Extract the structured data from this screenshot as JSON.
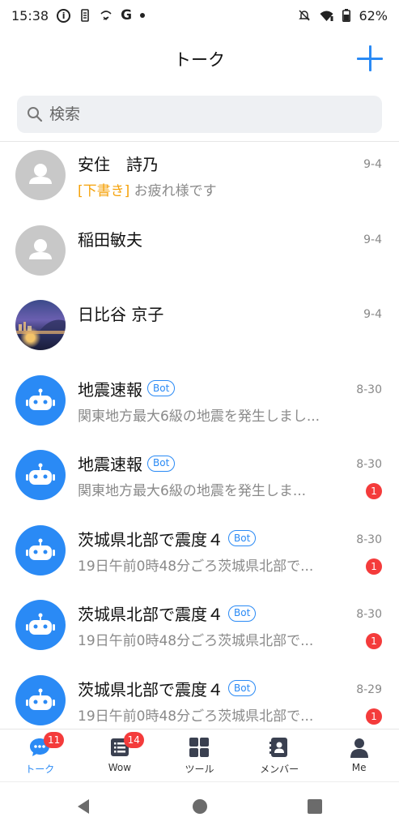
{
  "status_bar": {
    "time": "15:38",
    "g_letter": "G",
    "battery": "62%"
  },
  "header": {
    "title": "トーク"
  },
  "search": {
    "placeholder": "検索"
  },
  "chats": [
    {
      "name": "安住　詩乃",
      "draft_label": "[下書き]",
      "preview": "お疲れ様です",
      "date": "9-4",
      "avatar": "default-user-icon"
    },
    {
      "name": "稲田敏夫",
      "preview": "",
      "date": "9-4",
      "avatar": "default-user-icon"
    },
    {
      "name": "日比谷 京子",
      "preview": "",
      "date": "9-4",
      "avatar": "photo"
    },
    {
      "name": "地震速報",
      "bot": "Bot",
      "preview": "関東地方最大6級の地震を発生しまし...",
      "date": "8-30",
      "avatar": "robot-icon"
    },
    {
      "name": "地震速報",
      "bot": "Bot",
      "preview": "関東地方最大6級の地震を発生しま...",
      "date": "8-30",
      "unread": "1",
      "avatar": "robot-icon"
    },
    {
      "name": "茨城県北部で震度４",
      "bot": "Bot",
      "preview": "19日午前0時48分ごろ茨城県北部で...",
      "date": "8-30",
      "unread": "1",
      "avatar": "robot-icon"
    },
    {
      "name": "茨城県北部で震度４",
      "bot": "Bot",
      "preview": "19日午前0時48分ごろ茨城県北部で...",
      "date": "8-30",
      "unread": "1",
      "avatar": "robot-icon"
    },
    {
      "name": "茨城県北部で震度４",
      "bot": "Bot",
      "preview": "19日午前0時48分ごろ茨城県北部で...",
      "date": "8-29",
      "unread": "1",
      "avatar": "robot-icon"
    }
  ],
  "bottom_nav": [
    {
      "label": "トーク",
      "badge": "11",
      "icon": "chat-bubble-icon",
      "active": true
    },
    {
      "label": "Wow",
      "badge": "14",
      "icon": "list-icon",
      "active": false
    },
    {
      "label": "ツール",
      "icon": "grid-icon",
      "active": false
    },
    {
      "label": "メンバー",
      "icon": "contact-card-icon",
      "active": false
    },
    {
      "label": "Me",
      "icon": "person-icon",
      "active": false
    }
  ],
  "colors": {
    "accent": "#2a8af5",
    "draft": "#f5a20a",
    "badge": "#f43b3b",
    "muted_text": "#8a8a8a"
  }
}
